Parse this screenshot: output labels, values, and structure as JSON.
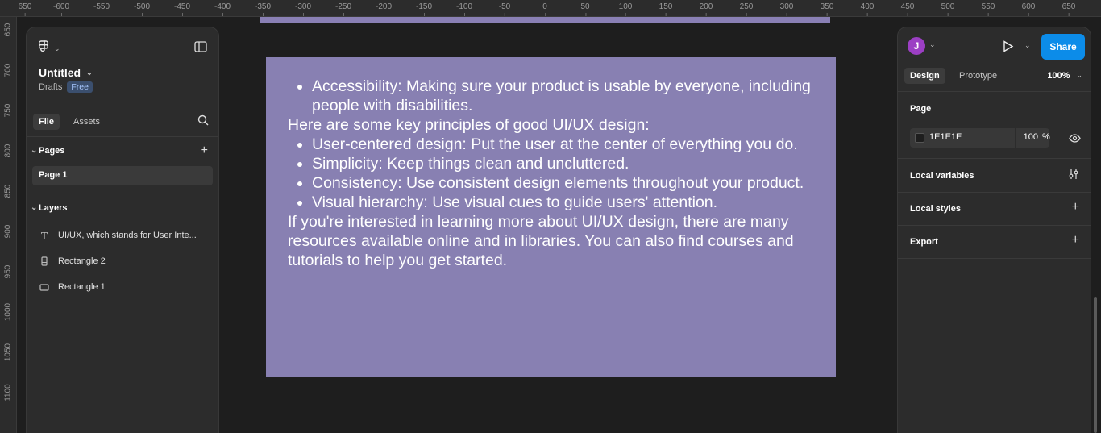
{
  "ruler": {
    "top_ticks": [
      "650",
      "-600",
      "-550",
      "-500",
      "-450",
      "-400",
      "-350",
      "-300",
      "-250",
      "-200",
      "-150",
      "-100",
      "-50",
      "0",
      "50",
      "100",
      "150",
      "200",
      "250",
      "300",
      "350",
      "400",
      "450",
      "500",
      "550",
      "600",
      "650"
    ],
    "left_ticks": [
      "650",
      "700",
      "750",
      "800",
      "850",
      "900",
      "950",
      "1000",
      "1050",
      "1100"
    ]
  },
  "file": {
    "title": "Untitled",
    "location": "Drafts",
    "plan_badge": "Free"
  },
  "left_tabs": {
    "file": "File",
    "assets": "Assets"
  },
  "pages": {
    "header": "Pages",
    "items": [
      "Page 1"
    ]
  },
  "layers": {
    "header": "Layers",
    "items": [
      {
        "name": "UI/UX, which stands for User Inte...",
        "icon": "text-icon"
      },
      {
        "name": "Rectangle 2",
        "icon": "rectangle-vertical-icon"
      },
      {
        "name": "Rectangle 1",
        "icon": "rectangle-icon"
      }
    ]
  },
  "canvas_text": {
    "bullets_1": [
      "Accessibility: Making sure your product is usable by everyone, including people with disabilities."
    ],
    "para_1": "Here are some key principles of good UI/UX design:",
    "bullets_2": [
      "User-centered design: Put the user at the center of everything you do.",
      "Simplicity: Keep things clean and uncluttered.",
      "Consistency: Use consistent design elements throughout your product.",
      "Visual hierarchy: Use visual cues to guide users' attention."
    ],
    "para_2": "If you're interested in learning more about UI/UX design, there are many resources available online and in libraries. You can also find courses and tutorials to help you get started."
  },
  "right": {
    "avatar_initial": "J",
    "share_label": "Share",
    "tabs": {
      "design": "Design",
      "prototype": "Prototype"
    },
    "zoom": "100%",
    "page_section": {
      "title": "Page",
      "color_hex": "1E1E1E",
      "opacity": "100",
      "opacity_unit": "%"
    },
    "local_variables": "Local variables",
    "local_styles": "Local styles",
    "export": "Export"
  },
  "colors": {
    "frame_fill": "#8880b2",
    "share_blue": "#0c8ce9",
    "avatar_purple": "#9c3fc4",
    "canvas_bg": "#1e1e1e"
  }
}
